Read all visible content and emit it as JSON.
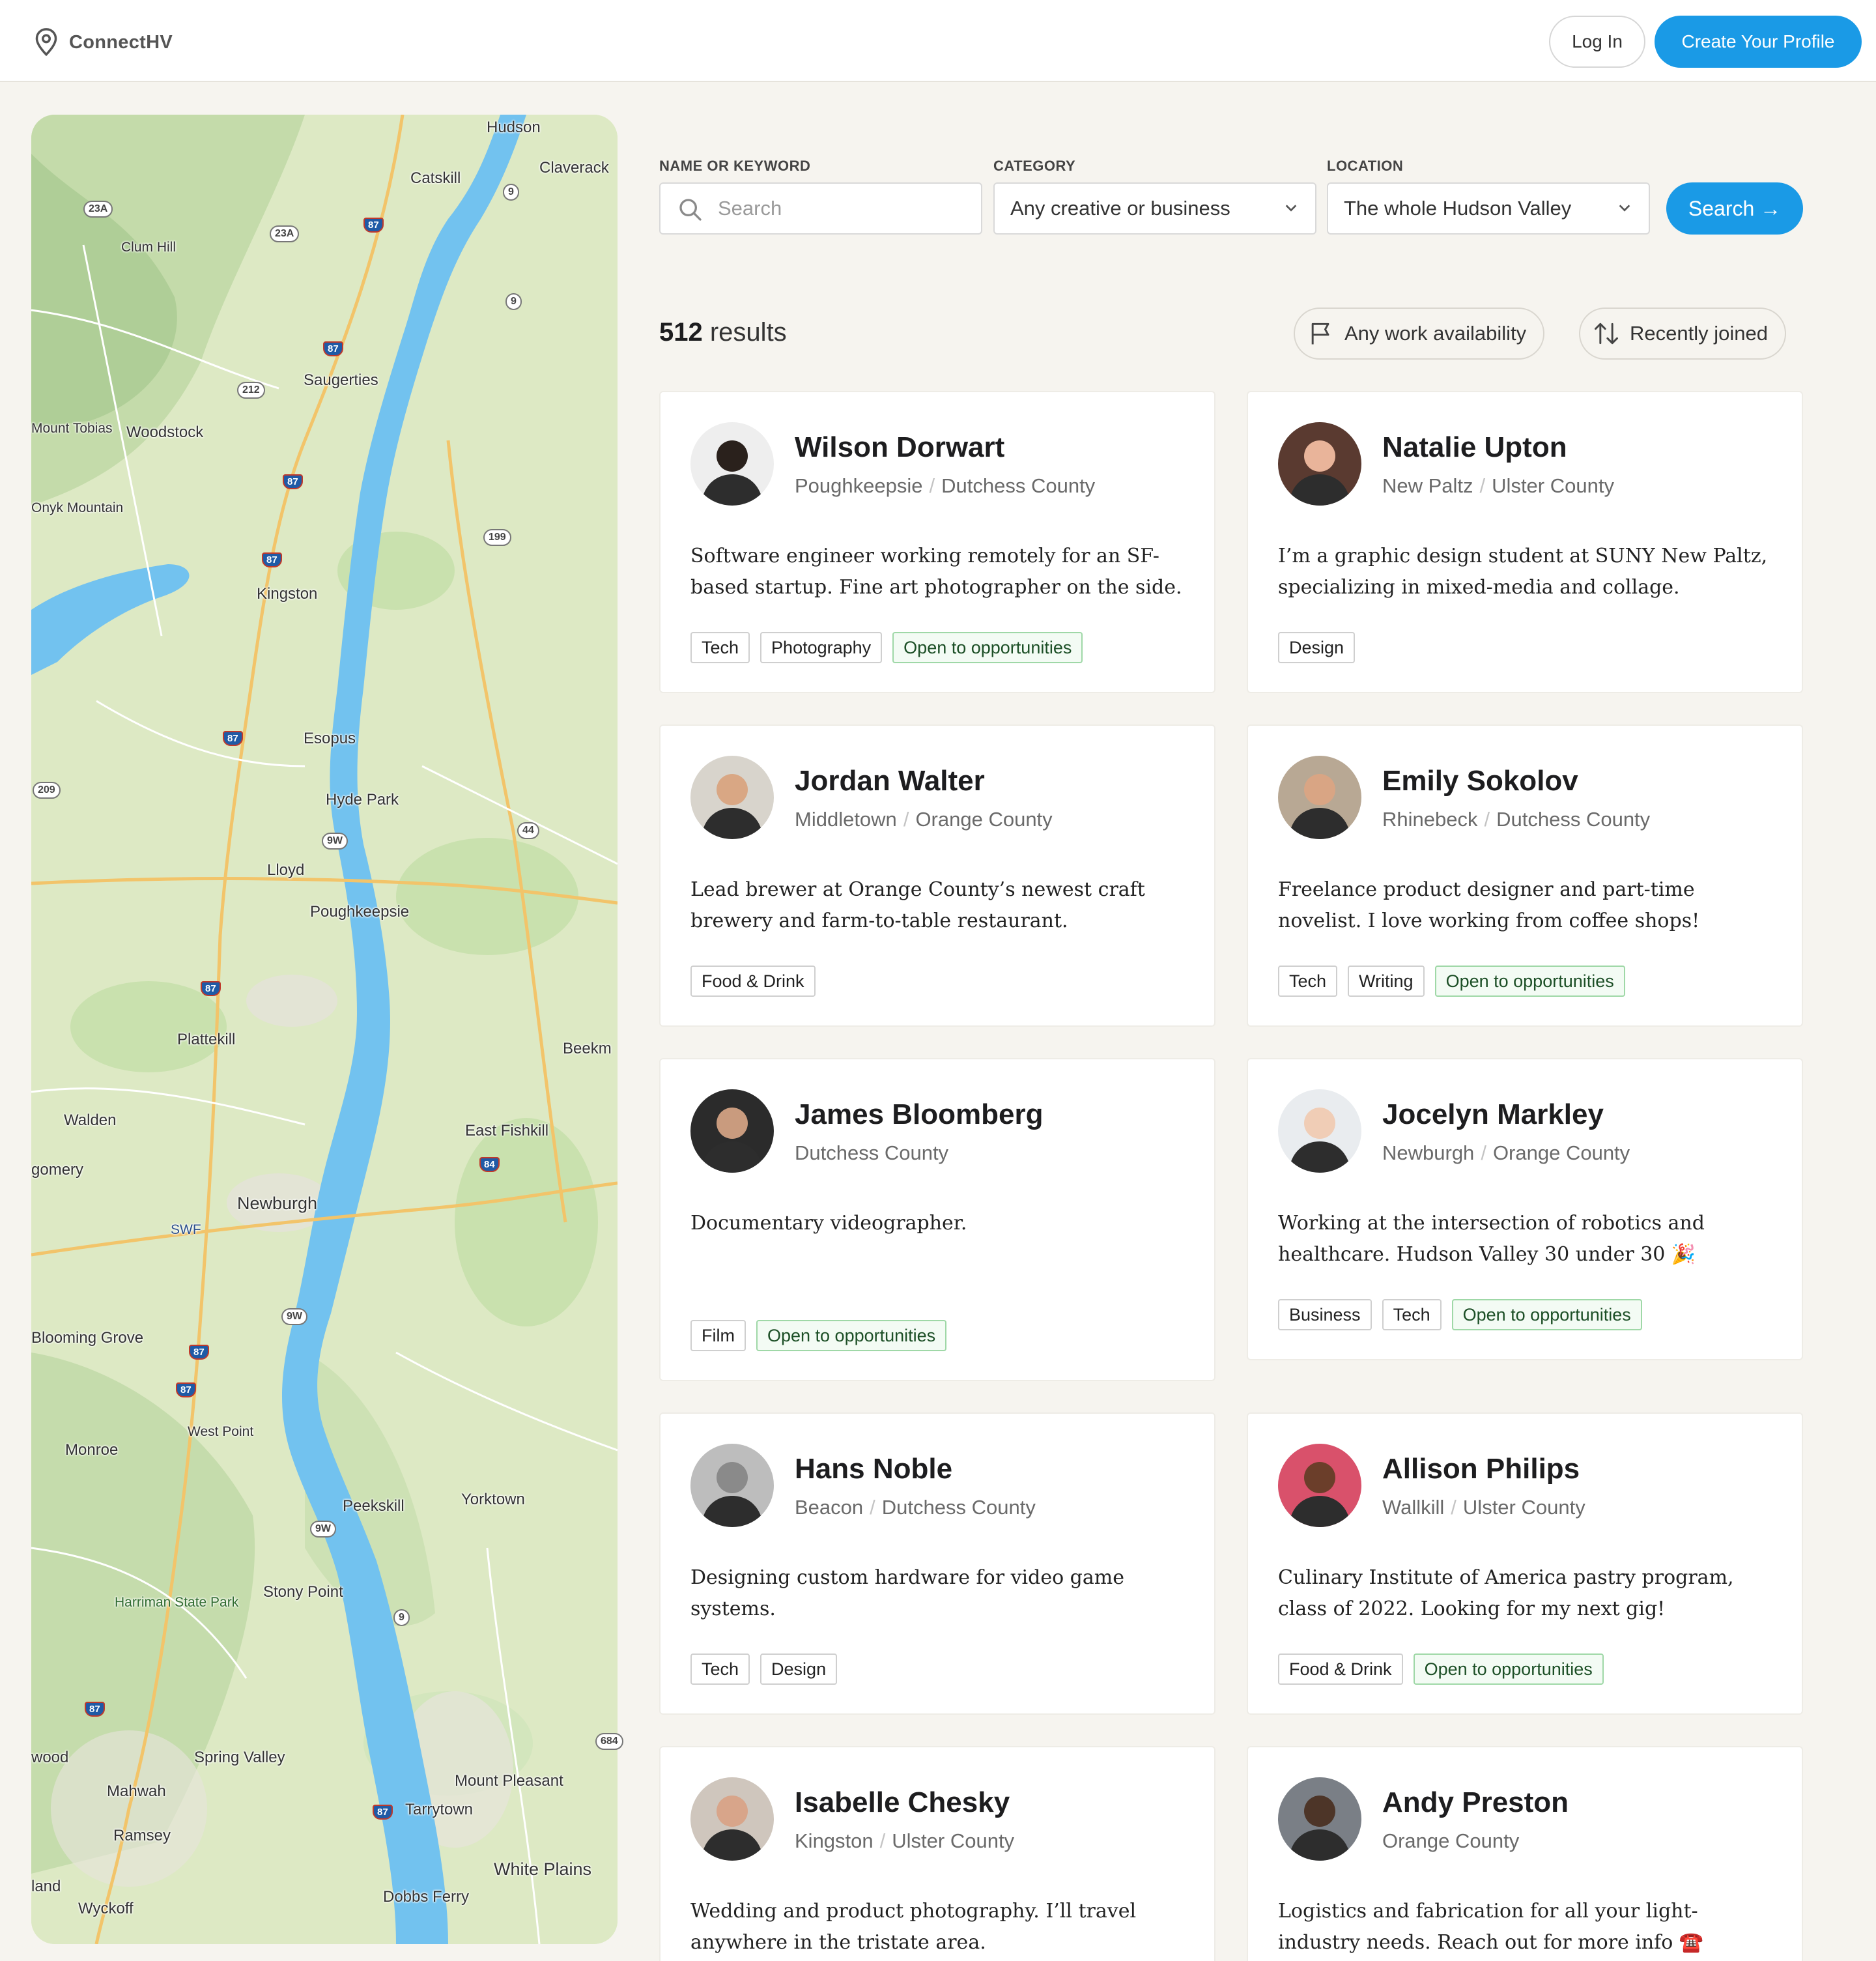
{
  "header": {
    "brand": "ConnectHV",
    "login_label": "Log In",
    "create_label": "Create Your Profile"
  },
  "filters": {
    "keyword_label": "NAME OR KEYWORD",
    "keyword_placeholder": "Search",
    "category_label": "CATEGORY",
    "category_value": "Any creative or business",
    "location_label": "LOCATION",
    "location_value": "The whole Hudson Valley",
    "search_label": "Search →"
  },
  "results": {
    "count": "512",
    "count_suffix": " results",
    "availability_label": "Any work availability",
    "sort_label": "Recently joined"
  },
  "map": {
    "labels": [
      "Hudson",
      "Claverack",
      "Catskill",
      "Clum Hill",
      "Saugerties",
      "Mount Tobias",
      "Woodstock",
      "Onyk Mountain",
      "Kingston",
      "Esopus",
      "Hyde Park",
      "Lloyd",
      "Poughkeepsie",
      "Plattekill",
      "Beekm",
      "Walden",
      "East Fishkill",
      "gomery",
      "Newburgh",
      "SWF",
      "Blooming Grove",
      "West Point",
      "Monroe",
      "Yorktown",
      "Peekskill",
      "Harriman State Park",
      "Stony Point",
      "Spring Valley",
      "wood",
      "Mahwah",
      "Mount Pleasant",
      "Tarrytown",
      "Ramsey",
      "White Plains",
      "land",
      "Wyckoff",
      "Dobbs Ferry"
    ],
    "shields": [
      "23A",
      "23A",
      "9",
      "87",
      "9",
      "87",
      "212",
      "87",
      "199",
      "87",
      "87",
      "209",
      "9W",
      "44",
      "87",
      "84",
      "9W",
      "87",
      "87",
      "9W",
      "9",
      "87",
      "684",
      "87"
    ]
  },
  "profiles": [
    {
      "name": "Wilson Dorwart",
      "town": "Poughkeepsie",
      "county": "Dutchess County",
      "bio": "Software engineer working remotely for an SF-based startup. Fine art photographer on the side.",
      "tags": [
        "Tech",
        "Photography"
      ],
      "open": "Open to opportunities",
      "avatar_bg": "#eeeeee",
      "avatar_skin": "#2a211c"
    },
    {
      "name": "Natalie Upton",
      "town": "New Paltz",
      "county": "Ulster County",
      "bio": "I’m a graphic design student at SUNY New Paltz, specializing in mixed-media and collage.",
      "tags": [
        "Design"
      ],
      "open": "",
      "avatar_bg": "#5a3a30",
      "avatar_skin": "#e9b49a"
    },
    {
      "name": "Jordan Walter",
      "town": "Middletown",
      "county": "Orange County",
      "bio": "Lead brewer at Orange County’s newest craft brewery and farm-to-table restaurant.",
      "tags": [
        "Food & Drink"
      ],
      "open": "",
      "avatar_bg": "#d8d4cc",
      "avatar_skin": "#d9a784"
    },
    {
      "name": "Emily Sokolov",
      "town": "Rhinebeck",
      "county": "Dutchess County",
      "bio": "Freelance product designer and part-time novelist. I love working from coffee shops!",
      "tags": [
        "Tech",
        "Writing"
      ],
      "open": "Open to opportunities",
      "avatar_bg": "#b8a894",
      "avatar_skin": "#d9a584"
    },
    {
      "name": "James Bloomberg",
      "town": "",
      "county": "Dutchess County",
      "bio": "Documentary videographer.",
      "tags": [
        "Film"
      ],
      "open": "Open to opportunities",
      "avatar_bg": "#2b2b2b",
      "avatar_skin": "#c99b7e"
    },
    {
      "name": "Jocelyn Markley",
      "town": "Newburgh",
      "county": "Orange County",
      "bio": "Working at the intersection of robotics and healthcare. Hudson Valley 30 under 30 🎉",
      "tags": [
        "Business",
        "Tech"
      ],
      "open": "Open to opportunities",
      "avatar_bg": "#e9ecef",
      "avatar_skin": "#f0cdb6"
    },
    {
      "name": "Hans Noble",
      "town": "Beacon",
      "county": "Dutchess County",
      "bio": "Designing custom hardware for video game systems.",
      "tags": [
        "Tech",
        "Design"
      ],
      "open": "",
      "avatar_bg": "#bdbdbd",
      "avatar_skin": "#8a8a8a"
    },
    {
      "name": "Allison Philips",
      "town": "Wallkill",
      "county": "Ulster County",
      "bio": "Culinary Institute of America pastry program, class of 2022. Looking for my next gig!",
      "tags": [
        "Food & Drink"
      ],
      "open": "Open to opportunities",
      "avatar_bg": "#d9516b",
      "avatar_skin": "#6b3e2a"
    },
    {
      "name": "Isabelle Chesky",
      "town": "Kingston",
      "county": "Ulster County",
      "bio": "Wedding and product photography. I’ll travel anywhere in the tristate area.",
      "tags": [],
      "open": "",
      "avatar_bg": "#cfc6bd",
      "avatar_skin": "#d8a58a"
    },
    {
      "name": "Andy Preston",
      "town": "",
      "county": "Orange County",
      "bio": "Logistics and fabrication for all your light-industry needs. Reach out for more info ☎️",
      "tags": [],
      "open": "",
      "avatar_bg": "#7a7f86",
      "avatar_skin": "#4d3528"
    }
  ]
}
